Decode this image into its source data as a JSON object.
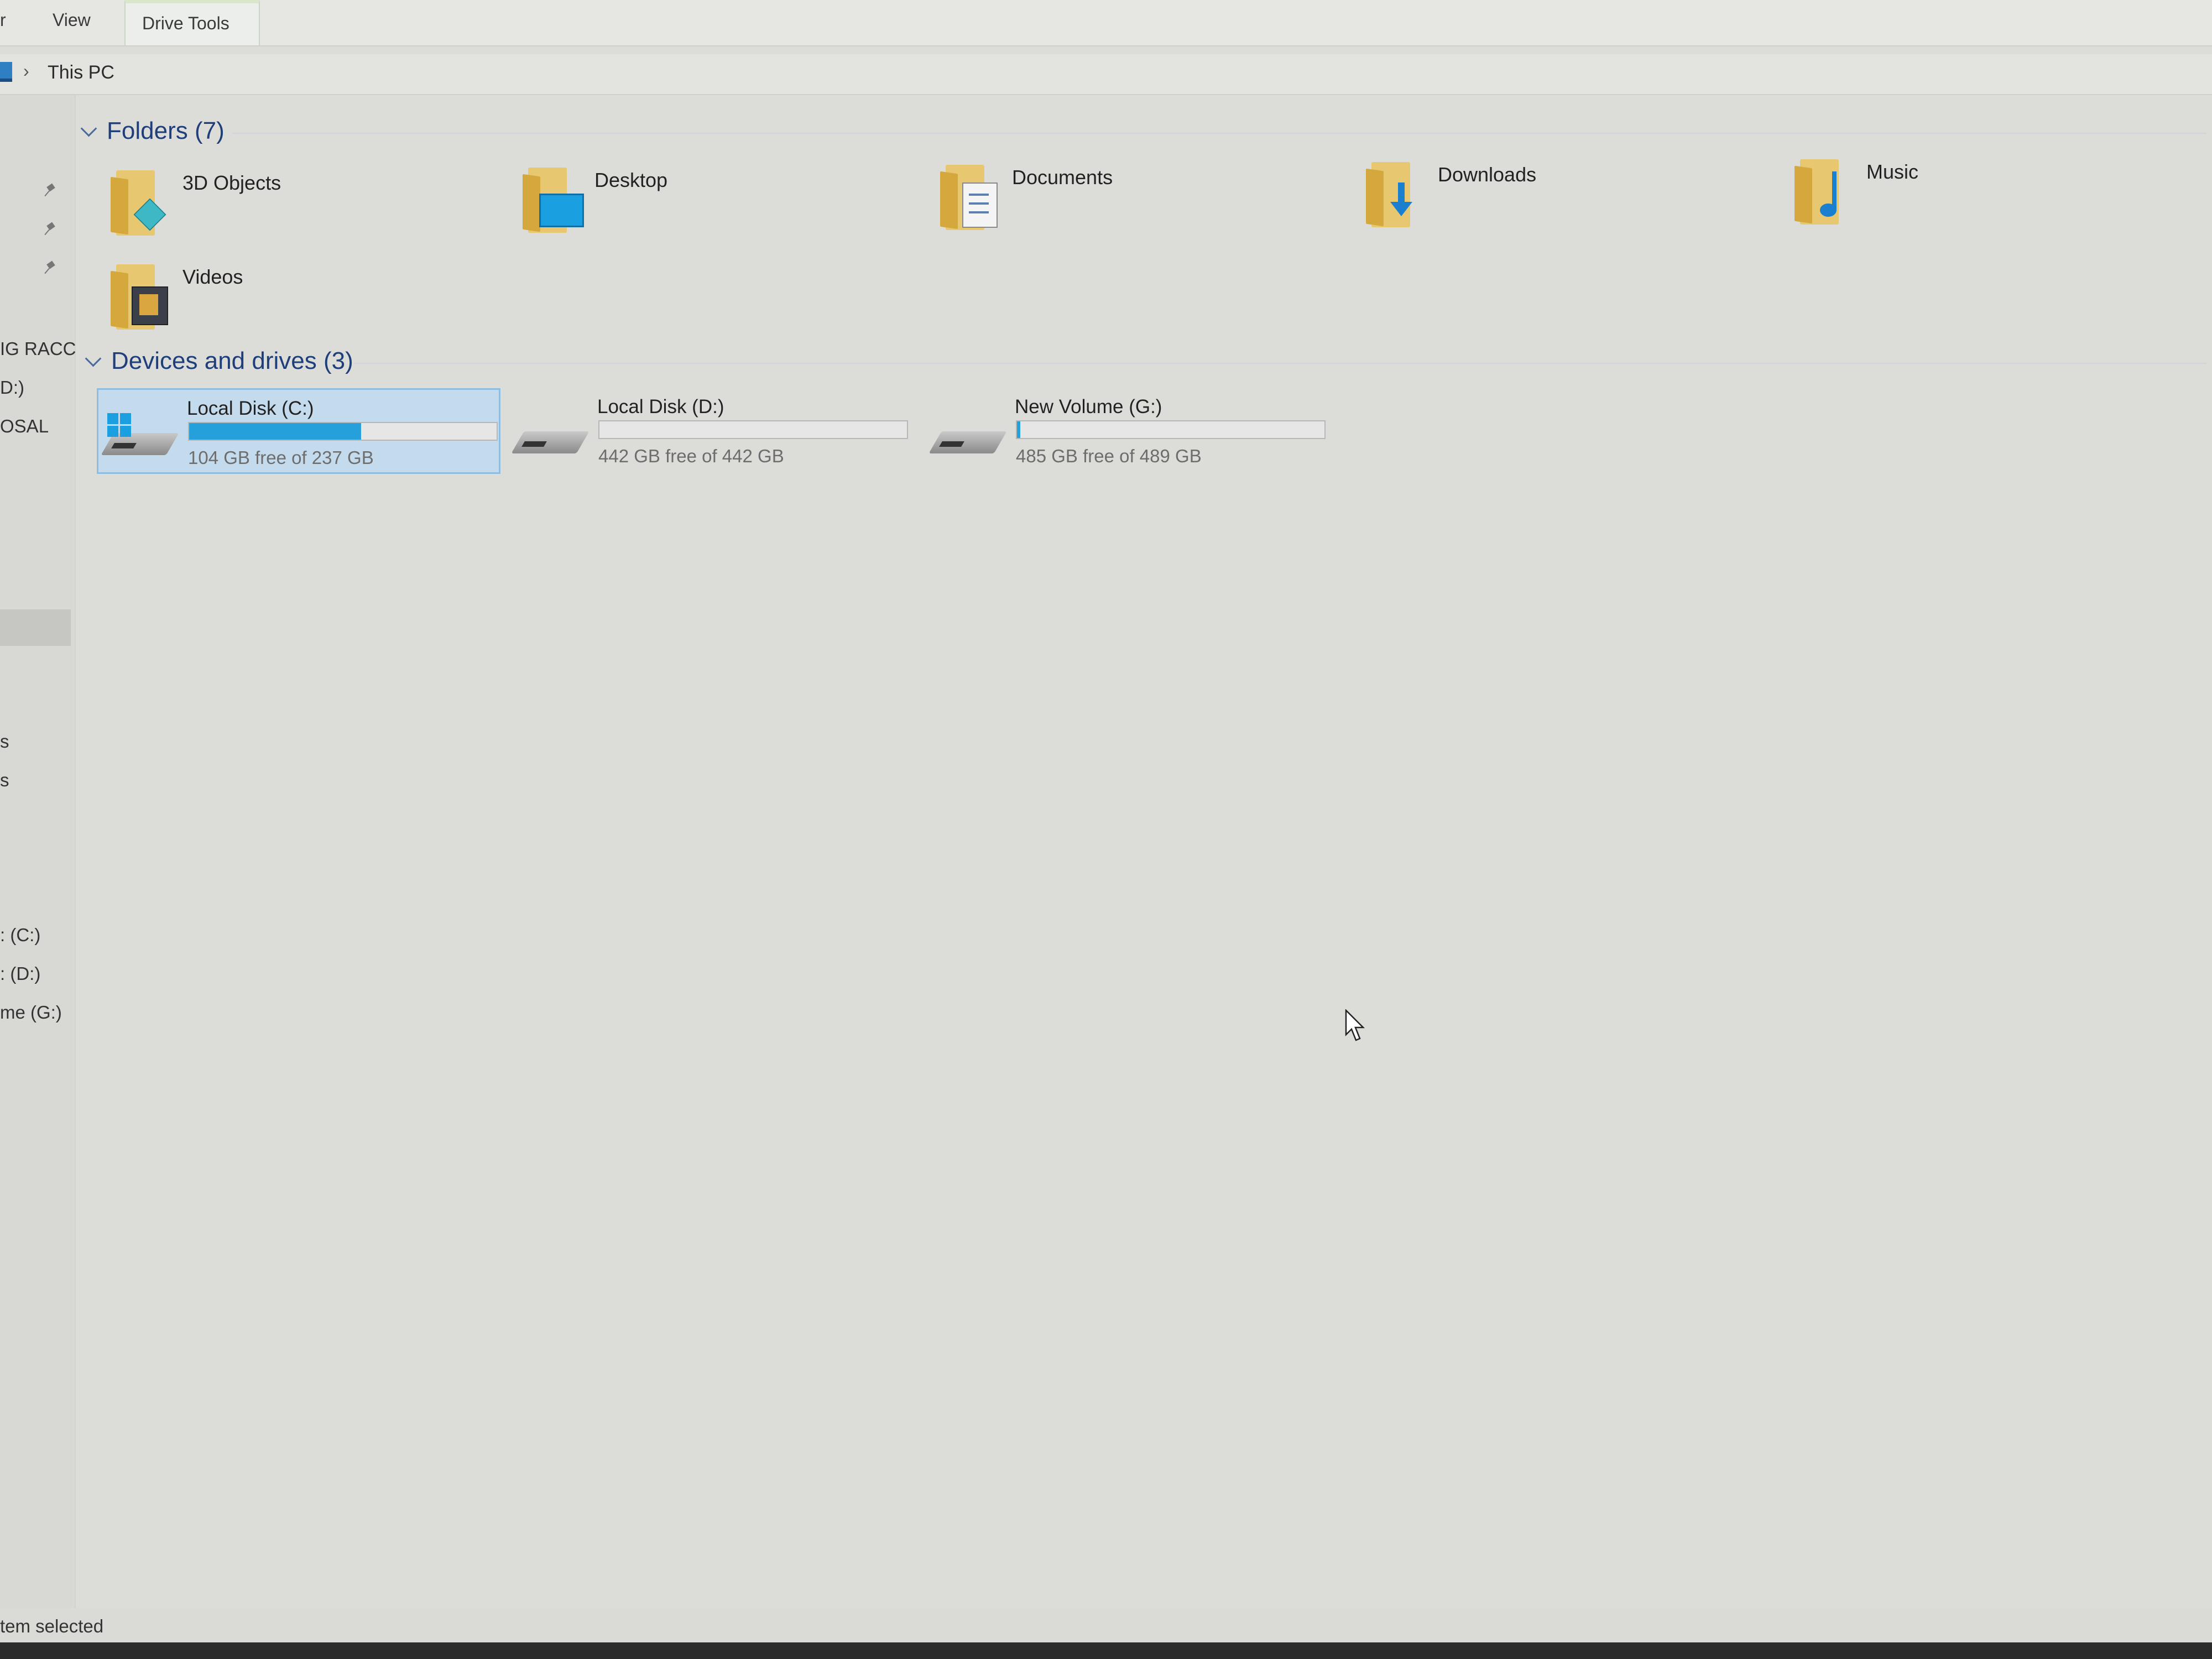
{
  "ribbon": {
    "tabs": [
      {
        "label": "r"
      },
      {
        "label": "View"
      },
      {
        "label": "Drive Tools"
      }
    ]
  },
  "address": {
    "separator": "›",
    "location": "This PC"
  },
  "nav": {
    "items": [
      {
        "label": "IG RACC"
      },
      {
        "label": "D:)"
      },
      {
        "label": "OSAL"
      },
      {
        "label": "s"
      },
      {
        "label": "s"
      },
      {
        "label": ": (C:)"
      },
      {
        "label": ": (D:)"
      },
      {
        "label": "me (G:)"
      }
    ]
  },
  "folders_group": {
    "title": "Folders (7)",
    "items": [
      {
        "label": "3D Objects",
        "icon": "3d-objects-folder-icon"
      },
      {
        "label": "Desktop",
        "icon": "desktop-folder-icon"
      },
      {
        "label": "Documents",
        "icon": "documents-folder-icon"
      },
      {
        "label": "Downloads",
        "icon": "downloads-folder-icon"
      },
      {
        "label": "Music",
        "icon": "music-folder-icon"
      },
      {
        "label": "Videos",
        "icon": "videos-folder-icon"
      }
    ]
  },
  "drives_group": {
    "title": "Devices and drives (3)",
    "items": [
      {
        "name": "Local Disk (C:)",
        "free_text": "104 GB free of 237 GB",
        "used_fraction": 0.56,
        "selected": true
      },
      {
        "name": "Local Disk (D:)",
        "free_text": "442 GB free of 442 GB",
        "used_fraction": 0.0,
        "selected": false
      },
      {
        "name": "New Volume (G:)",
        "free_text": "485 GB free of 489 GB",
        "used_fraction": 0.01,
        "selected": false
      }
    ]
  },
  "status": {
    "text": "tem selected"
  },
  "colors": {
    "accent": "#26a0da",
    "selection": "#c3dbec",
    "group_title": "#1f3f7a",
    "folder": "#e7c770"
  }
}
